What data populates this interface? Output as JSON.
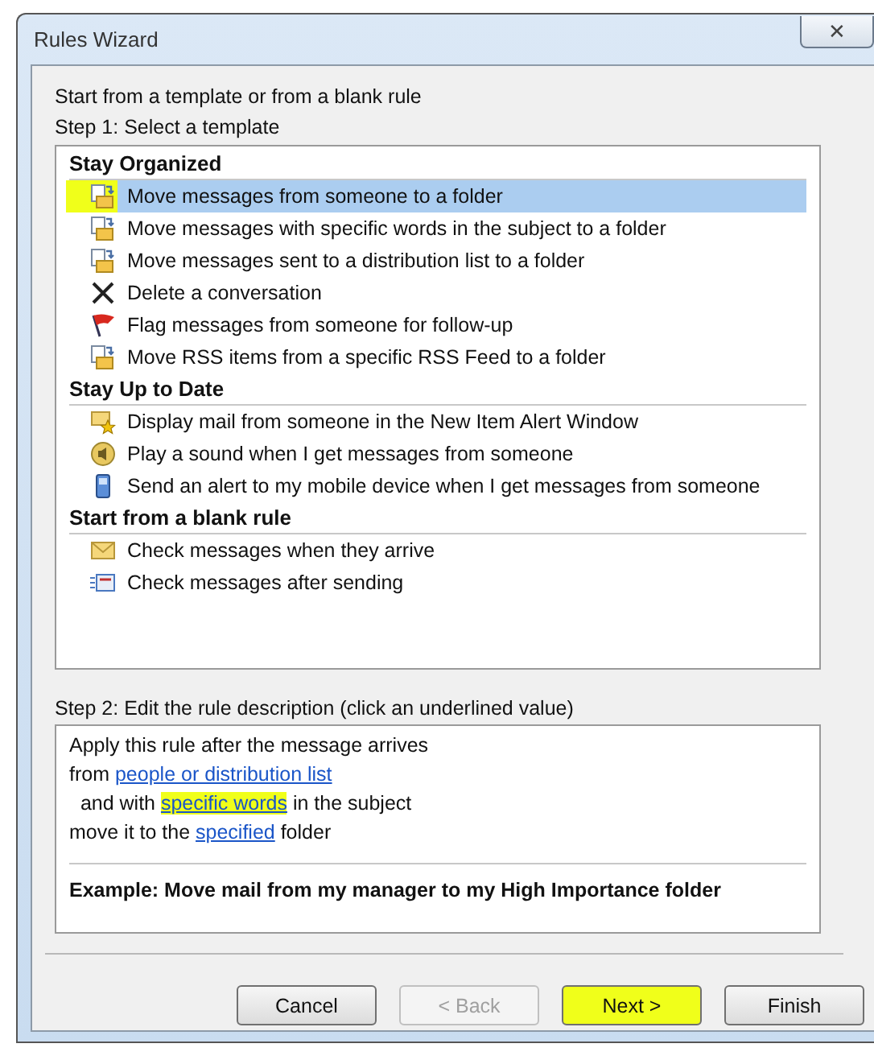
{
  "window": {
    "title": "Rules Wizard",
    "close": "✕"
  },
  "intro": "Start from a template or from a blank rule",
  "step1": "Step 1: Select a template",
  "groups": [
    {
      "heading": "Stay Organized",
      "items": [
        {
          "label": "Move messages from someone to a folder",
          "kind": "move",
          "selected": true,
          "highlighted": true
        },
        {
          "label": "Move messages with specific words in the subject to a folder",
          "kind": "move",
          "selected": false,
          "highlighted": false
        },
        {
          "label": "Move messages sent to a distribution list to a folder",
          "kind": "move",
          "selected": false,
          "highlighted": false
        },
        {
          "label": "Delete a conversation",
          "kind": "delete",
          "selected": false,
          "highlighted": false
        },
        {
          "label": "Flag messages from someone for follow-up",
          "kind": "flag",
          "selected": false,
          "highlighted": false
        },
        {
          "label": "Move RSS items from a specific RSS Feed to a folder",
          "kind": "move",
          "selected": false,
          "highlighted": false
        }
      ]
    },
    {
      "heading": "Stay Up to Date",
      "items": [
        {
          "label": "Display mail from someone in the New Item Alert Window",
          "kind": "alert",
          "selected": false,
          "highlighted": false
        },
        {
          "label": "Play a sound when I get messages from someone",
          "kind": "sound",
          "selected": false,
          "highlighted": false
        },
        {
          "label": "Send an alert to my mobile device when I get messages from someone",
          "kind": "mobile",
          "selected": false,
          "highlighted": false
        }
      ]
    },
    {
      "heading": "Start from a blank rule",
      "items": [
        {
          "label": "Check messages when they arrive",
          "kind": "envelope",
          "selected": false,
          "highlighted": false
        },
        {
          "label": "Check messages after sending",
          "kind": "sent",
          "selected": false,
          "highlighted": false
        }
      ]
    }
  ],
  "step2": "Step 2: Edit the rule description (click an underlined value)",
  "description": [
    [
      {
        "text": "Apply this rule after the message arrives",
        "kind": "text",
        "highlighted": false
      }
    ],
    [
      {
        "text": "from ",
        "kind": "text",
        "highlighted": false
      },
      {
        "text": "people or distribution list",
        "kind": "link",
        "highlighted": false
      }
    ],
    [
      {
        "text": "  and with ",
        "kind": "text",
        "highlighted": false
      },
      {
        "text": "specific words",
        "kind": "link",
        "highlighted": true
      },
      {
        "text": " in the subject",
        "kind": "text",
        "highlighted": false
      }
    ],
    [
      {
        "text": "move it to the ",
        "kind": "text",
        "highlighted": false
      },
      {
        "text": "specified",
        "kind": "link",
        "highlighted": false
      },
      {
        "text": " folder",
        "kind": "text",
        "highlighted": false
      }
    ]
  ],
  "example": "Example: Move mail from my manager to my High Importance folder",
  "buttons": [
    {
      "label": "Cancel",
      "disabled": false,
      "highlighted": false
    },
    {
      "label": "< Back",
      "disabled": true,
      "highlighted": false
    },
    {
      "label": "Next >",
      "disabled": false,
      "highlighted": true
    },
    {
      "label": "Finish",
      "disabled": false,
      "highlighted": false
    }
  ]
}
